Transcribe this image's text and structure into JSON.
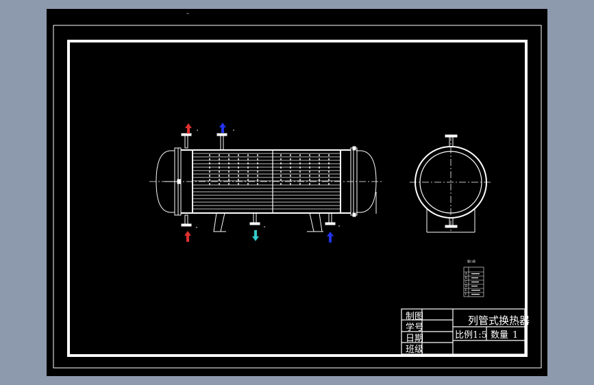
{
  "drawing": {
    "top_mark": "–",
    "title_block": {
      "row_labels": [
        "制图",
        "学号",
        "日期",
        "班级"
      ],
      "title": "列管式换热器",
      "scale_label": "比例",
      "scale_value": "1:5",
      "quantity_label": "数量",
      "quantity_value": "1"
    },
    "nozzle_table": {
      "title": "管口表",
      "rows": [
        "A",
        "B",
        "C",
        "D",
        "E",
        "F"
      ]
    },
    "colors": {
      "background": "#000000",
      "line": "#ffffff",
      "hot_arrow": "#e03030",
      "cold_arrow": "#2233ee",
      "outlet_arrow": "#33cccc"
    }
  }
}
